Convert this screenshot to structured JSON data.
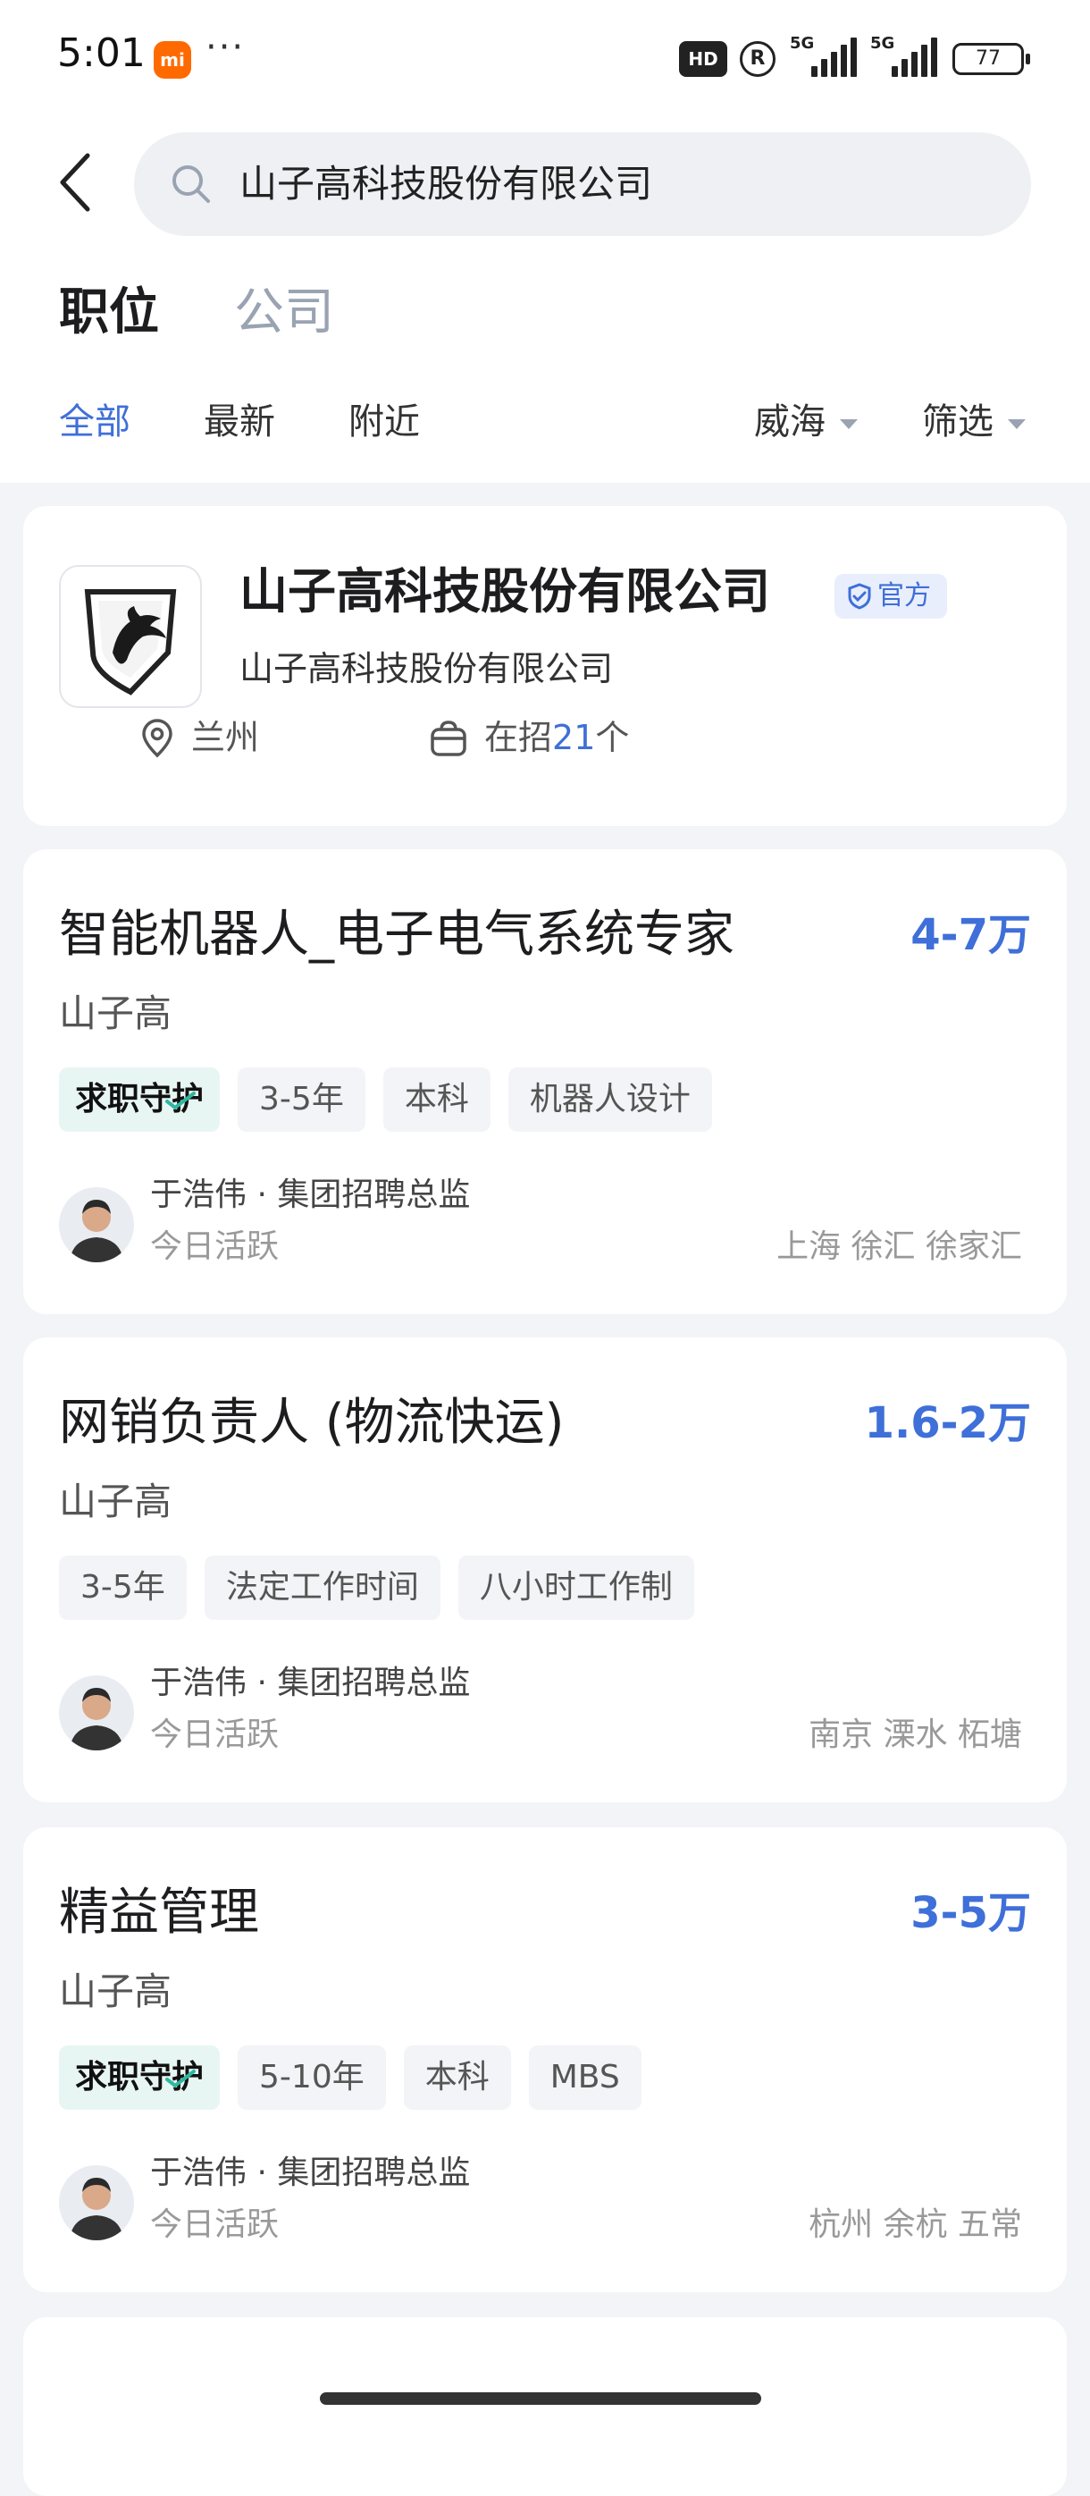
{
  "status_bar": {
    "time": "5:01",
    "mi_badge": "mi",
    "more_dots": "···",
    "hd_badge": "HD",
    "r_badge": "R",
    "signal1_label": "5G",
    "signal2_label": "5G",
    "battery": "77"
  },
  "search": {
    "query": "山子高科技股份有限公司"
  },
  "main_tabs": {
    "positions": "职位",
    "companies": "公司"
  },
  "filters": {
    "all": "全部",
    "latest": "最新",
    "nearby": "附近",
    "city": "威海",
    "filter": "筛选"
  },
  "company": {
    "name": "山子高科技股份有限公司",
    "badge": "官方",
    "subtitle": "山子高科技股份有限公司",
    "location": "兰州",
    "hiring_prefix": "在招",
    "hiring_count": "21",
    "hiring_suffix": "个"
  },
  "jobs": [
    {
      "title": "智能机器人_电子电气系统专家",
      "salary": "4-7万",
      "company": "山子高",
      "guard_tag": "求职守护",
      "tags": [
        "3-5年",
        "本科",
        "机器人设计"
      ],
      "recruiter": "于浩伟 · 集团招聘总监",
      "active": "今日活跃",
      "location": "上海 徐汇 徐家汇"
    },
    {
      "title": "网销负责人 (物流快运)",
      "salary": "1.6-2万",
      "company": "山子高",
      "tags": [
        "3-5年",
        "法定工作时间",
        "八小时工作制"
      ],
      "recruiter": "于浩伟 · 集团招聘总监",
      "active": "今日活跃",
      "location": "南京 溧水 柘塘"
    },
    {
      "title": "精益管理",
      "salary": "3-5万",
      "company": "山子高",
      "guard_tag": "求职守护",
      "tags": [
        "5-10年",
        "本科",
        "MBS"
      ],
      "recruiter": "于浩伟 · 集团招聘总监",
      "active": "今日活跃",
      "location": "杭州 余杭 五常"
    }
  ],
  "partial_card_text": "",
  "colors": {
    "accent": "#3f6fd8",
    "background": "#f3f4f7",
    "guard_tag_bg": "#e8f6f3"
  }
}
